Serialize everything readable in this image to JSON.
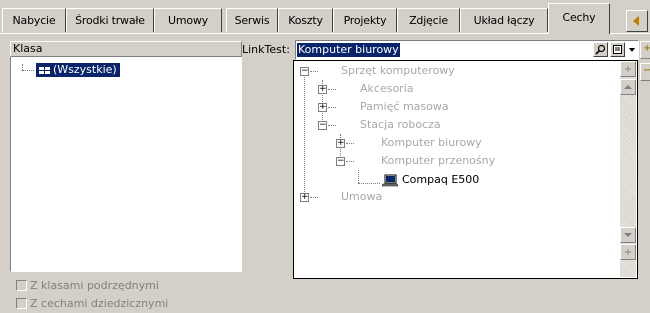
{
  "tabs": [
    {
      "label": "Nabycie"
    },
    {
      "label": "Środki trwałe"
    },
    {
      "label": "Umowy"
    },
    {
      "label": "Serwis"
    },
    {
      "label": "Koszty"
    },
    {
      "label": "Projekty"
    },
    {
      "label": "Zdjęcie"
    },
    {
      "label": "Układ łączy"
    },
    {
      "label": "Cechy"
    }
  ],
  "active_tab": "Cechy",
  "left_panel": {
    "header": "Klasa",
    "root_item": "(Wszystkie)",
    "checkbox_subclasses": "Z klasami podrzędnymi",
    "checkbox_inherited": "Z cechami dziedzicznymi"
  },
  "linktest": {
    "label": "LinkTest:",
    "value": "Komputer biurowy"
  },
  "tree": {
    "nodes": [
      {
        "label": "Sprzęt komputerowy",
        "expander": "−"
      },
      {
        "label": "Akcesoria",
        "expander": "+"
      },
      {
        "label": "Pamięć masowa",
        "expander": "+"
      },
      {
        "label": "Stacja robocza",
        "expander": "−"
      },
      {
        "label": "Komputer biurowy",
        "expander": "+"
      },
      {
        "label": "Komputer przenośny",
        "expander": "−"
      },
      {
        "label": "Compaq E500",
        "expander": ""
      },
      {
        "label": "Umowa",
        "expander": "+"
      }
    ]
  },
  "colors": {
    "selection": "#0a246a",
    "window_bg": "#d4d0c8",
    "disabled_text": "#a8a8a8"
  }
}
